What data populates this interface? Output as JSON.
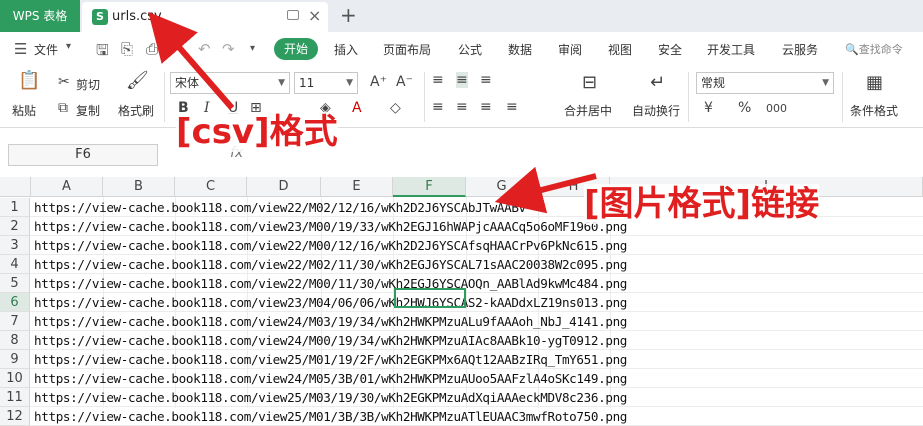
{
  "titlebar": {
    "app_name": "WPS 表格",
    "doc_icon_letter": "S",
    "doc_name": "urls.csv",
    "new_tab": "+"
  },
  "menu": {
    "file": "文件",
    "start": "开始",
    "items": [
      "插入",
      "页面布局",
      "公式",
      "数据",
      "审阅",
      "视图",
      "安全",
      "开发工具",
      "云服务"
    ],
    "search": "查找命令"
  },
  "ribbon": {
    "paste": "粘贴",
    "cut": "剪切",
    "copy": "复制",
    "format_painter": "格式刷",
    "font_name": "宋体",
    "font_size": "11",
    "bold": "B",
    "italic": "I",
    "underline": "U",
    "merge_center": "合并居中",
    "auto_wrap": "自动换行",
    "number_format": "常规",
    "currency": "¥",
    "percent": "%",
    "thousands": "000",
    "cond_format": "条件格式"
  },
  "formula_bar": {
    "cell_ref": "F6",
    "fx": "fx"
  },
  "grid": {
    "columns": [
      "A",
      "B",
      "C",
      "D",
      "E",
      "F",
      "G",
      "H",
      "I"
    ],
    "active_column": "F",
    "active_row": 6,
    "rows": [
      {
        "n": "1",
        "url": "https://view-cache.book118.com/view22/M02/12/16/wKh2D2J6YSCAbJTwAABv"
      },
      {
        "n": "2",
        "url": "https://view-cache.book118.com/view23/M00/19/33/wKh2EGJ16hWAPjcAAACq5o6oMF1960.png"
      },
      {
        "n": "3",
        "url": "https://view-cache.book118.com/view22/M00/12/16/wKh2D2J6YSCAfsqHAACrPv6PkNc615.png"
      },
      {
        "n": "4",
        "url": "https://view-cache.book118.com/view22/M02/11/30/wKh2EGJ6YSCAL71sAAC20038W2c095.png"
      },
      {
        "n": "5",
        "url": "https://view-cache.book118.com/view22/M00/11/30/wKh2EGJ6YSCAOQn_AABlAd9kwMc484.png"
      },
      {
        "n": "6",
        "url": "https://view-cache.book118.com/view23/M04/06/06/wKh2HWJ6YSCAS2-kAADdxLZ19ns013.png"
      },
      {
        "n": "7",
        "url": "https://view-cache.book118.com/view24/M03/19/34/wKh2HWKPMzuALu9fAAAoh_NbJ_4141.png"
      },
      {
        "n": "8",
        "url": "https://view-cache.book118.com/view24/M00/19/34/wKh2HWKPMzuAIAc8AABk10-ygT0912.png"
      },
      {
        "n": "9",
        "url": "https://view-cache.book118.com/view25/M01/19/2F/wKh2EGKPMx6AQt12AABzIRq_TmY651.png"
      },
      {
        "n": "10",
        "url": "https://view-cache.book118.com/view24/M05/3B/01/wKh2HWKPMzuAUoo5AAFzlA4oSKc149.png"
      },
      {
        "n": "11",
        "url": "https://view-cache.book118.com/view25/M03/19/30/wKh2EGKPMzuAdXqiAAAeckMDV8c236.png"
      },
      {
        "n": "12",
        "url": "https://view-cache.book118.com/view25/M01/3B/3B/wKh2HWKPMzuATlEUAAC3mwfRoto750.png"
      }
    ]
  },
  "annotations": {
    "csv": "[csv]格式",
    "image_format": "[图片格式]链接",
    "color": "#e02020"
  },
  "colors": {
    "brand_green": "#2e9c5f",
    "annotation_red": "#e02020"
  }
}
